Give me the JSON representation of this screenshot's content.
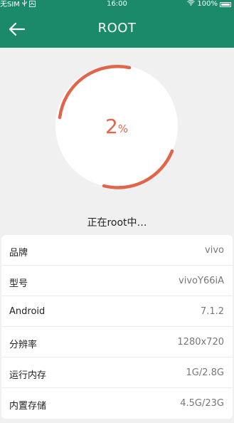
{
  "status_bar": {
    "carrier": "无SIM",
    "time": "16:00",
    "battery": "100%"
  },
  "toolbar": {
    "title": "ROOT"
  },
  "progress": {
    "value": 2,
    "value_text": "2",
    "unit": "%",
    "status": "正在root中…"
  },
  "device_info": [
    {
      "label": "品牌",
      "value": "vivo"
    },
    {
      "label": "型号",
      "value": "vivoY66iA"
    },
    {
      "label": "Android",
      "value": "7.1.2"
    },
    {
      "label": "分辨率",
      "value": "1280x720"
    },
    {
      "label": "运行内存",
      "value": "1G/2.8G"
    },
    {
      "label": "内置存储",
      "value": "4.5G/23G"
    }
  ],
  "colors": {
    "primary": "#1a8a6a",
    "accent": "#e0654a",
    "background": "#f0f0f0"
  },
  "icons": {
    "back": "arrow-left-icon",
    "wifi": "wifi-icon",
    "battery": "battery-icon"
  }
}
